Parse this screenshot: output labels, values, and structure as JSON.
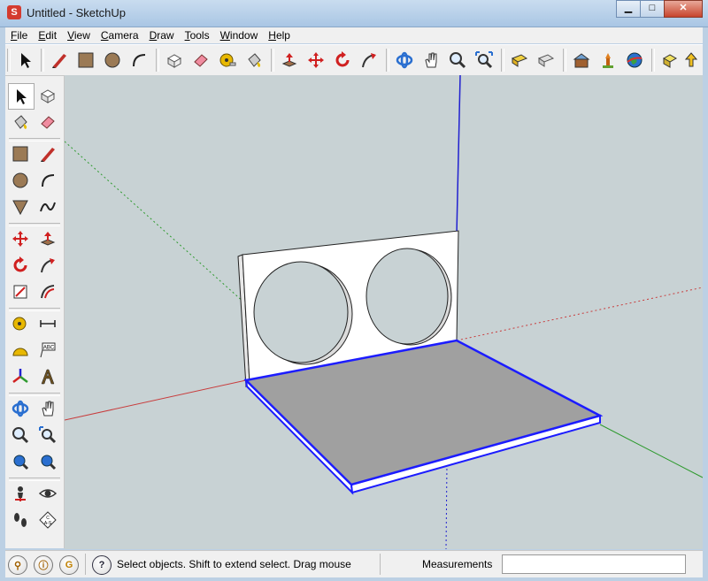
{
  "window": {
    "title": "Untitled - SketchUp",
    "app_icon_letter": "S"
  },
  "menu": [
    {
      "accel": "F",
      "rest": "ile"
    },
    {
      "accel": "E",
      "rest": "dit"
    },
    {
      "accel": "V",
      "rest": "iew"
    },
    {
      "accel": "C",
      "rest": "amera"
    },
    {
      "accel": "D",
      "rest": "raw"
    },
    {
      "accel": "T",
      "rest": "ools"
    },
    {
      "accel": "W",
      "rest": "indow"
    },
    {
      "accel": "H",
      "rest": "elp"
    }
  ],
  "status": {
    "message": "Select objects. Shift to extend select. Drag mouse",
    "help_glyph": "?",
    "measurements_label": "Measurements",
    "measurements_value": "",
    "icons": [
      "geo-location-icon",
      "credits-icon",
      "google-sign-in-icon"
    ],
    "icon_glyphs": [
      "⚲",
      "ⓘ",
      "G"
    ]
  },
  "left_toolbar_text": {
    "dimension": "ABC",
    "protractor_marks": "C\nA-S"
  },
  "colors": {
    "axis_red": "#c83c3c",
    "axis_green": "#2e9a2e",
    "axis_blue": "#2020d0",
    "selection": "#1c1cff",
    "floor_gray": "#a0a0a0",
    "panel_white": "#ffffff",
    "viewport_bg": "#c8d2d4"
  }
}
